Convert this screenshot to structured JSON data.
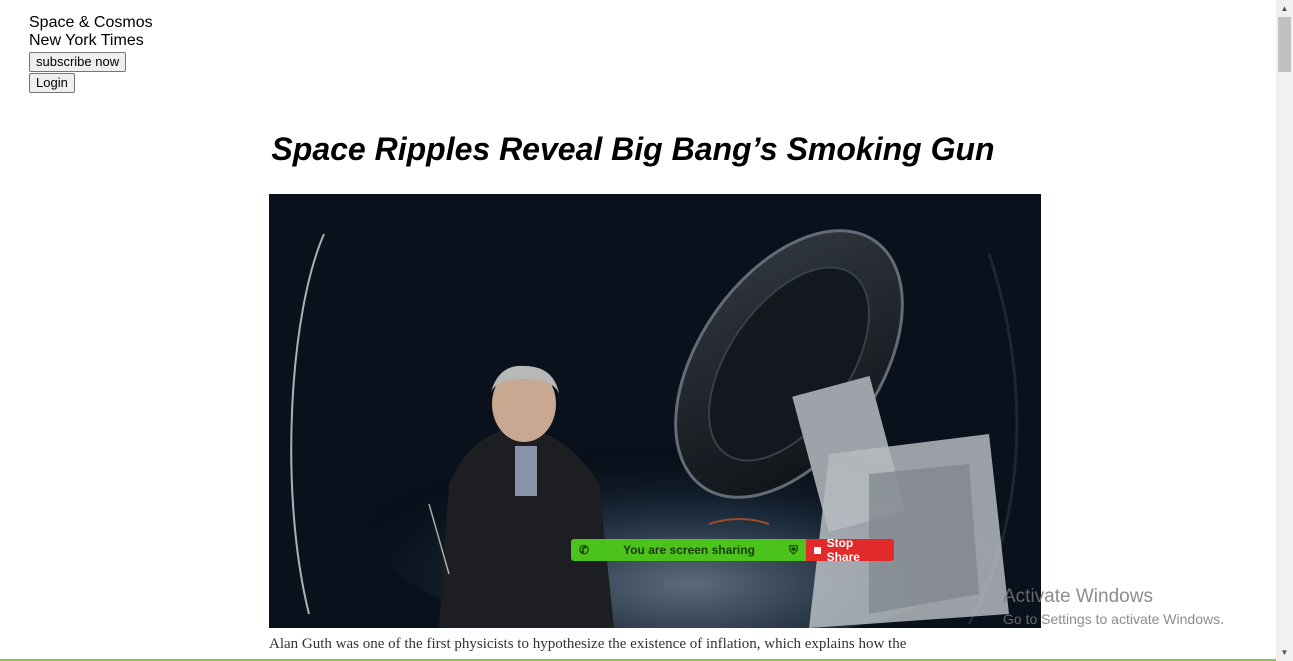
{
  "header": {
    "section": "Space & Cosmos",
    "publication": "New York Times",
    "subscribe_label": "subscribe now",
    "login_label": "Login"
  },
  "article": {
    "headline": "Space Ripples Reveal Big Bang’s Smoking Gun",
    "caption": "Alan Guth was one of the first physicists to hypothesize the existence of inflation, which explains how the"
  },
  "screen_share": {
    "status": "You are screen sharing",
    "stop_label": "Stop Share",
    "status_color": "#4cc21c",
    "stop_color": "#e32a2a"
  },
  "windows_watermark": {
    "line1": "Activate Windows",
    "line2": "Go to Settings to activate Windows."
  }
}
